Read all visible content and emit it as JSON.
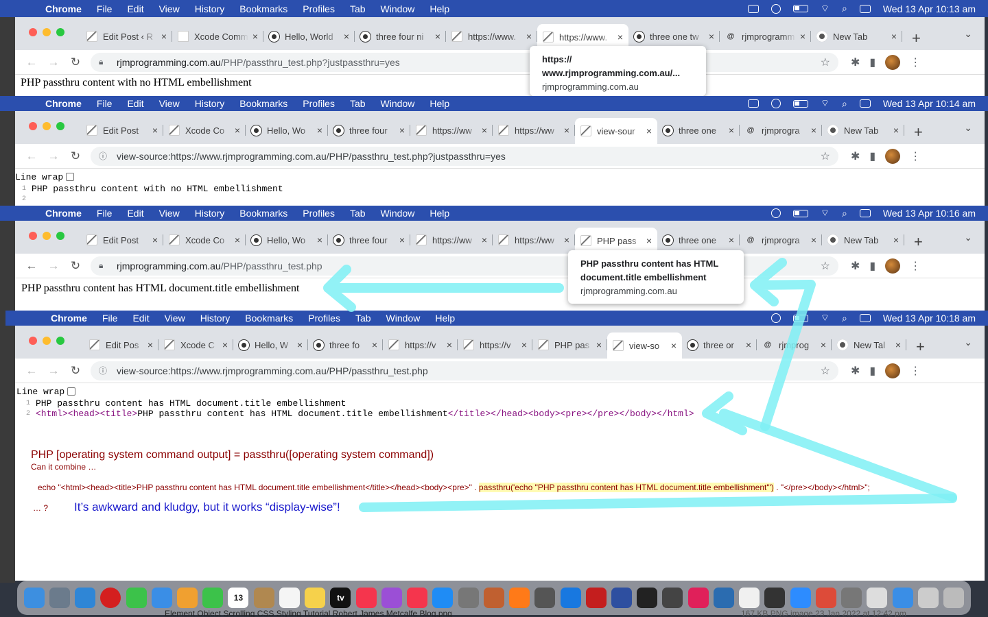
{
  "menubar": {
    "app": "Chrome",
    "items": [
      "File",
      "Edit",
      "View",
      "History",
      "Bookmarks",
      "Profiles",
      "Tab",
      "Window",
      "Help"
    ],
    "times": [
      "Wed 13 Apr  10:13 am",
      "Wed 13 Apr  10:14 am",
      "Wed 13 Apr  10:16 am",
      "Wed 13 Apr  10:18 am"
    ]
  },
  "window1": {
    "tabs": [
      {
        "title": "Edit Post ‹ R",
        "icon": "quill"
      },
      {
        "title": "Xcode Comm",
        "icon": "blank"
      },
      {
        "title": "Hello, World",
        "icon": "gh"
      },
      {
        "title": "three four ni",
        "icon": "gh"
      },
      {
        "title": "https://www.",
        "icon": "quill"
      },
      {
        "title": "https://www.",
        "icon": "quill",
        "active": true
      },
      {
        "title": "three one tw",
        "icon": "gh"
      },
      {
        "title": "rjmprogramm",
        "icon": "at"
      },
      {
        "title": "New Tab",
        "icon": "chromeicon"
      }
    ],
    "url_host": "rjmprogramming.com.au",
    "url_path": "/PHP/passthru_test.php?justpassthru=yes",
    "page_text": "PHP passthru content with no HTML embellishment",
    "popup_title_line1": "https://",
    "popup_title_line2": "www.rjmprogramming.com.au/...",
    "popup_host": "rjmprogramming.com.au"
  },
  "window2": {
    "tabs": [
      {
        "title": "Edit Post",
        "icon": "quill"
      },
      {
        "title": "Xcode Co",
        "icon": "quill"
      },
      {
        "title": "Hello, Wo",
        "icon": "gh"
      },
      {
        "title": "three four",
        "icon": "gh"
      },
      {
        "title": "https://ww",
        "icon": "quill"
      },
      {
        "title": "https://ww",
        "icon": "quill"
      },
      {
        "title": "view-sour",
        "icon": "quill",
        "active": true
      },
      {
        "title": "three one",
        "icon": "gh"
      },
      {
        "title": "rjmprogra",
        "icon": "at"
      },
      {
        "title": "New Tab",
        "icon": "chromeicon"
      }
    ],
    "url": "view-source:https://www.rjmprogramming.com.au/PHP/passthru_test.php?justpassthru=yes",
    "line_wrap": "Line wrap",
    "source_line1": "PHP passthru content with no HTML embellishment",
    "ln1": "1",
    "ln2": "2"
  },
  "window3": {
    "tabs": [
      {
        "title": "Edit Post",
        "icon": "quill"
      },
      {
        "title": "Xcode Co",
        "icon": "quill"
      },
      {
        "title": "Hello, Wo",
        "icon": "gh"
      },
      {
        "title": "three four",
        "icon": "gh"
      },
      {
        "title": "https://ww",
        "icon": "quill"
      },
      {
        "title": "https://ww",
        "icon": "quill"
      },
      {
        "title": "PHP pass",
        "icon": "quill",
        "active": true
      },
      {
        "title": "three one",
        "icon": "gh"
      },
      {
        "title": "rjmprogra",
        "icon": "at"
      },
      {
        "title": "New Tab",
        "icon": "chromeicon"
      }
    ],
    "url_host": "rjmprogramming.com.au",
    "url_path": "/PHP/passthru_test.php",
    "page_text": "PHP passthru content has HTML document.title embellishment",
    "popup_title_line1": "PHP passthru content has HTML",
    "popup_title_line2": "document.title embellishment",
    "popup_host": "rjmprogramming.com.au"
  },
  "window4": {
    "tabs": [
      {
        "title": "Edit Pos",
        "icon": "quill"
      },
      {
        "title": "Xcode C",
        "icon": "quill"
      },
      {
        "title": "Hello, W",
        "icon": "gh"
      },
      {
        "title": "three fo",
        "icon": "gh"
      },
      {
        "title": "https://v",
        "icon": "quill"
      },
      {
        "title": "https://v",
        "icon": "quill"
      },
      {
        "title": "PHP pas",
        "icon": "quill"
      },
      {
        "title": "view-so",
        "icon": "quill",
        "active": true
      },
      {
        "title": "three or",
        "icon": "gh"
      },
      {
        "title": "rjmprog",
        "icon": "at"
      },
      {
        "title": "New Tal",
        "icon": "chromeicon"
      }
    ],
    "url": "view-source:https://www.rjmprogramming.com.au/PHP/passthru_test.php",
    "line_wrap": "Line wrap",
    "ln1": "1",
    "ln2": "2",
    "source_line1": "PHP passthru content has HTML document.title embellishment",
    "src2_open": "<html><head><title>",
    "src2_text": "PHP passthru content has HTML document.title embellishment",
    "src2_close": "</title></head><body><pre></pre></body></html>"
  },
  "annotation": {
    "heading": "PHP [operating system command output] = passthru([operating system command])",
    "sub": "Can it combine …",
    "code_pre": "echo \"<html><head><title>PHP passthru content has HTML document.title embellishment</title></head><body><pre>\" . ",
    "code_hl": "passthru('echo \"PHP passthru content has HTML document.title embellishment\"')",
    "code_post": " . \"</pre></body></html>\";",
    "question": "… ?",
    "conclusion": "It’s awkward and kludgy, but it works “display-wise”!"
  },
  "dock": {
    "calendar_day": "13",
    "tv_label": "tv",
    "items": [
      "finder",
      "launchpad",
      "safari",
      "opera",
      "messages",
      "mail",
      "photos",
      "facetime",
      "calendar",
      "contacts",
      "reminders",
      "notes",
      "tv",
      "music",
      "podcasts",
      "news",
      "appstore",
      "settings",
      "paint",
      "firefox",
      "calculator",
      "xcode",
      "filezilla",
      "bbedit",
      "terminal",
      "gimp-like",
      "intellij",
      "preview",
      "textedit",
      "gnome",
      "zoom",
      "chrome",
      "script",
      "textedit2",
      "folder",
      "image",
      "trash"
    ]
  },
  "finder_bottom": {
    "filename": "Element Object Scrolling CSS Styling Tutorial  Robert James Metcalfe Blog.png",
    "info": "167 KB   PNG image            23 Jan 2022 at 12:42 pm"
  },
  "colors": {
    "menubar": "#2b4fae",
    "arrow": "#7ff0f5",
    "annotation_red": "#8b0000",
    "annotation_blue": "#1a1acc"
  }
}
